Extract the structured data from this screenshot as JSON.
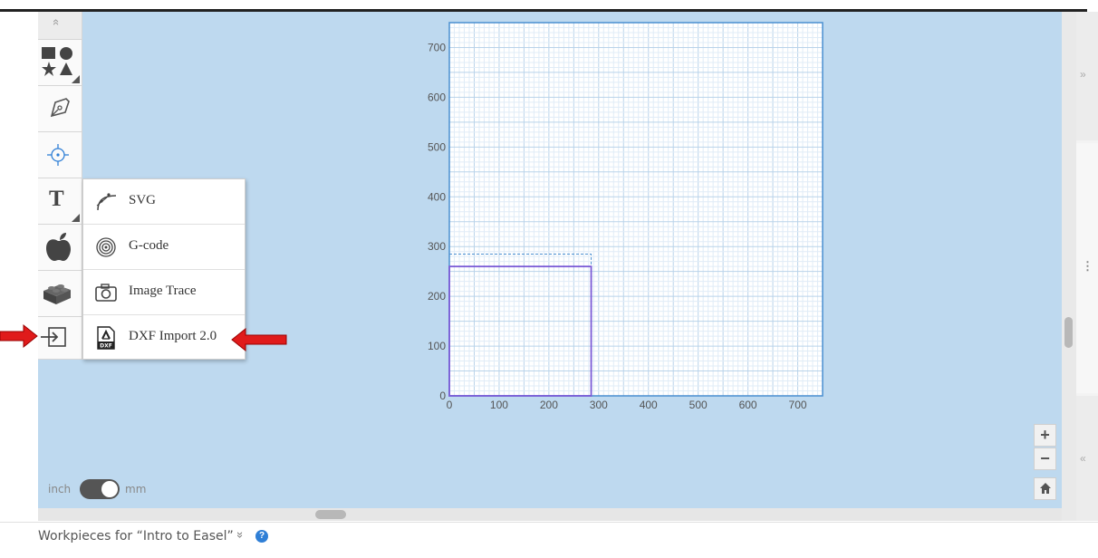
{
  "toolbar": {
    "collapse": "«",
    "items": [
      {
        "name": "shapes"
      },
      {
        "name": "pen"
      },
      {
        "name": "crosshair"
      },
      {
        "name": "text",
        "label": "T"
      },
      {
        "name": "apple"
      },
      {
        "name": "lego"
      },
      {
        "name": "import"
      }
    ]
  },
  "import_menu": {
    "items": [
      {
        "label": "SVG",
        "icon": "svg-curve-icon"
      },
      {
        "label": "G-code",
        "icon": "gcode-rings-icon"
      },
      {
        "label": "Image Trace",
        "icon": "camera-icon"
      },
      {
        "label": "DXF Import 2.0",
        "icon": "dxf-file-icon"
      }
    ]
  },
  "chart_data": {
    "type": "grid",
    "x_ticks": [
      "0",
      "100",
      "200",
      "300",
      "400",
      "500",
      "600",
      "700"
    ],
    "y_ticks": [
      "0",
      "100",
      "200",
      "300",
      "400",
      "500",
      "600",
      "700"
    ],
    "xlim": [
      0,
      750
    ],
    "ylim": [
      0,
      750
    ],
    "material": {
      "width": 285,
      "height": 260
    },
    "material_outline": {
      "width": 285,
      "height": 285
    }
  },
  "units": {
    "left": "inch",
    "right": "mm",
    "selected": "mm"
  },
  "zoom": {
    "plus": "+",
    "minus": "−"
  },
  "footer": {
    "workpieces": "Workpieces for “Intro to Easel”",
    "chevron": "»",
    "help": "?"
  },
  "right_panel": {
    "collapse_top": "»",
    "collapse_bottom": "«",
    "handle": "⋮"
  },
  "colors": {
    "canvas": "#bed9ef",
    "grid_line": "#4a8fd1",
    "material": "#7b5bd6",
    "arrow": "#e01b1b"
  }
}
